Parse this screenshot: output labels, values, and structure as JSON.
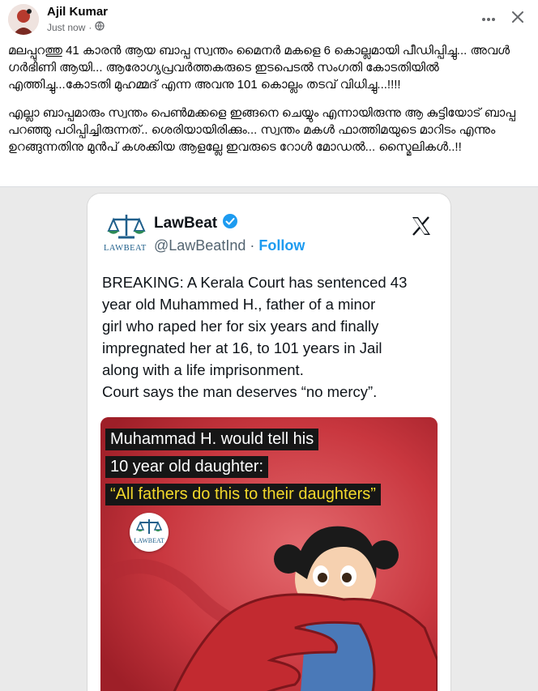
{
  "header": {
    "author": "Ajil Kumar",
    "timestamp": "Just now",
    "privacy_icon": "globe-icon",
    "more_icon": "more-options-icon",
    "close_icon": "close-icon"
  },
  "post_text": {
    "paragraph1": "മലപ്പുറത്തു 41 കാരൻ ആയ ബാപ്പ സ്വന്തം മൈനർ മകളെ 6 കൊല്ലമായി പീഡിപ്പിച്ചു... അവൾ ഗർഭിണി ആയി... ആരോഗ്യപ്രവർത്തകരുടെ ഇടപെടൽ സംഗതി കോടതിയിൽ എത്തിച്ചു...കോടതി മുഹമ്മദ് എന്ന അവനു 101 കൊല്ലം തടവ് വിധിച്ചു...!!!!",
    "paragraph2": "എല്ലാ ബാപ്പമാരും സ്വന്തം പെൺമക്കളെ ഇങ്ങനെ ചെയ്യും എന്നായിരുന്നു ആ കുട്ടിയോട് ബാപ്പ പറഞ്ഞു പഠിപ്പിച്ചിരുന്നത്.. ശെരിയായിരിക്കും... സ്വന്തം മകൾ ഫാത്തിമയുടെ മാറിടം എന്നും ഉറങ്ങുന്നതിനു മുൻപ് കശക്കിയ ആളല്ലേ ഇവരുടെ റോൾ മോഡൽ... സ്മൈലികൾ..!!"
  },
  "embedded_tweet": {
    "logo_text": "LAWBEAT",
    "account_name": "LawBeat",
    "handle": "@LawBeatInd",
    "separator": "·",
    "follow_label": "Follow",
    "verified_icon": "verified-badge-icon",
    "platform_icon": "x-logo-icon",
    "text_lines": [
      "BREAKING: A Kerala Court has sentenced 43",
      "year old Muhammed H., father of a minor",
      "girl who raped her for six years and finally",
      "impregnated her at 16, to 101 years in Jail",
      "along with a life imprisonment.",
      "Court says the man deserves “no mercy”."
    ]
  },
  "poster": {
    "line1": "Muhammad H. would tell his",
    "line2": "10 year old daughter:",
    "line3": "“All fathers do this to their daughters”",
    "logo_text": "LAWBEAT",
    "accent_red": "#c9373f",
    "caption_yellow": "#f3d92b"
  },
  "colors": {
    "link_blue": "#1d9bf0",
    "meta_gray": "#65676b"
  }
}
